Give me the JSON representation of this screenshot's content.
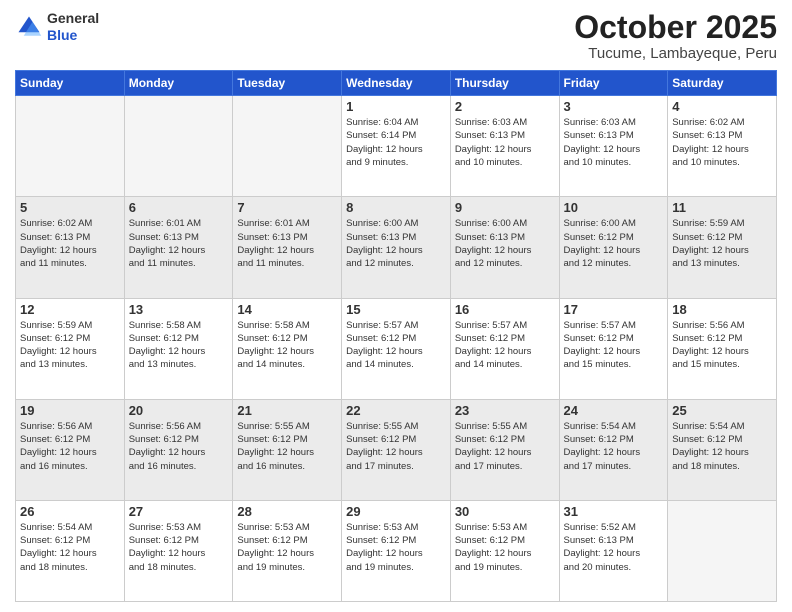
{
  "logo": {
    "general": "General",
    "blue": "Blue"
  },
  "header": {
    "month": "October 2025",
    "location": "Tucume, Lambayeque, Peru"
  },
  "weekdays": [
    "Sunday",
    "Monday",
    "Tuesday",
    "Wednesday",
    "Thursday",
    "Friday",
    "Saturday"
  ],
  "weeks": [
    {
      "shaded": false,
      "days": [
        {
          "num": "",
          "info": ""
        },
        {
          "num": "",
          "info": ""
        },
        {
          "num": "",
          "info": ""
        },
        {
          "num": "1",
          "info": "Sunrise: 6:04 AM\nSunset: 6:14 PM\nDaylight: 12 hours\nand 9 minutes."
        },
        {
          "num": "2",
          "info": "Sunrise: 6:03 AM\nSunset: 6:13 PM\nDaylight: 12 hours\nand 10 minutes."
        },
        {
          "num": "3",
          "info": "Sunrise: 6:03 AM\nSunset: 6:13 PM\nDaylight: 12 hours\nand 10 minutes."
        },
        {
          "num": "4",
          "info": "Sunrise: 6:02 AM\nSunset: 6:13 PM\nDaylight: 12 hours\nand 10 minutes."
        }
      ]
    },
    {
      "shaded": true,
      "days": [
        {
          "num": "5",
          "info": "Sunrise: 6:02 AM\nSunset: 6:13 PM\nDaylight: 12 hours\nand 11 minutes."
        },
        {
          "num": "6",
          "info": "Sunrise: 6:01 AM\nSunset: 6:13 PM\nDaylight: 12 hours\nand 11 minutes."
        },
        {
          "num": "7",
          "info": "Sunrise: 6:01 AM\nSunset: 6:13 PM\nDaylight: 12 hours\nand 11 minutes."
        },
        {
          "num": "8",
          "info": "Sunrise: 6:00 AM\nSunset: 6:13 PM\nDaylight: 12 hours\nand 12 minutes."
        },
        {
          "num": "9",
          "info": "Sunrise: 6:00 AM\nSunset: 6:13 PM\nDaylight: 12 hours\nand 12 minutes."
        },
        {
          "num": "10",
          "info": "Sunrise: 6:00 AM\nSunset: 6:12 PM\nDaylight: 12 hours\nand 12 minutes."
        },
        {
          "num": "11",
          "info": "Sunrise: 5:59 AM\nSunset: 6:12 PM\nDaylight: 12 hours\nand 13 minutes."
        }
      ]
    },
    {
      "shaded": false,
      "days": [
        {
          "num": "12",
          "info": "Sunrise: 5:59 AM\nSunset: 6:12 PM\nDaylight: 12 hours\nand 13 minutes."
        },
        {
          "num": "13",
          "info": "Sunrise: 5:58 AM\nSunset: 6:12 PM\nDaylight: 12 hours\nand 13 minutes."
        },
        {
          "num": "14",
          "info": "Sunrise: 5:58 AM\nSunset: 6:12 PM\nDaylight: 12 hours\nand 14 minutes."
        },
        {
          "num": "15",
          "info": "Sunrise: 5:57 AM\nSunset: 6:12 PM\nDaylight: 12 hours\nand 14 minutes."
        },
        {
          "num": "16",
          "info": "Sunrise: 5:57 AM\nSunset: 6:12 PM\nDaylight: 12 hours\nand 14 minutes."
        },
        {
          "num": "17",
          "info": "Sunrise: 5:57 AM\nSunset: 6:12 PM\nDaylight: 12 hours\nand 15 minutes."
        },
        {
          "num": "18",
          "info": "Sunrise: 5:56 AM\nSunset: 6:12 PM\nDaylight: 12 hours\nand 15 minutes."
        }
      ]
    },
    {
      "shaded": true,
      "days": [
        {
          "num": "19",
          "info": "Sunrise: 5:56 AM\nSunset: 6:12 PM\nDaylight: 12 hours\nand 16 minutes."
        },
        {
          "num": "20",
          "info": "Sunrise: 5:56 AM\nSunset: 6:12 PM\nDaylight: 12 hours\nand 16 minutes."
        },
        {
          "num": "21",
          "info": "Sunrise: 5:55 AM\nSunset: 6:12 PM\nDaylight: 12 hours\nand 16 minutes."
        },
        {
          "num": "22",
          "info": "Sunrise: 5:55 AM\nSunset: 6:12 PM\nDaylight: 12 hours\nand 17 minutes."
        },
        {
          "num": "23",
          "info": "Sunrise: 5:55 AM\nSunset: 6:12 PM\nDaylight: 12 hours\nand 17 minutes."
        },
        {
          "num": "24",
          "info": "Sunrise: 5:54 AM\nSunset: 6:12 PM\nDaylight: 12 hours\nand 17 minutes."
        },
        {
          "num": "25",
          "info": "Sunrise: 5:54 AM\nSunset: 6:12 PM\nDaylight: 12 hours\nand 18 minutes."
        }
      ]
    },
    {
      "shaded": false,
      "days": [
        {
          "num": "26",
          "info": "Sunrise: 5:54 AM\nSunset: 6:12 PM\nDaylight: 12 hours\nand 18 minutes."
        },
        {
          "num": "27",
          "info": "Sunrise: 5:53 AM\nSunset: 6:12 PM\nDaylight: 12 hours\nand 18 minutes."
        },
        {
          "num": "28",
          "info": "Sunrise: 5:53 AM\nSunset: 6:12 PM\nDaylight: 12 hours\nand 19 minutes."
        },
        {
          "num": "29",
          "info": "Sunrise: 5:53 AM\nSunset: 6:12 PM\nDaylight: 12 hours\nand 19 minutes."
        },
        {
          "num": "30",
          "info": "Sunrise: 5:53 AM\nSunset: 6:12 PM\nDaylight: 12 hours\nand 19 minutes."
        },
        {
          "num": "31",
          "info": "Sunrise: 5:52 AM\nSunset: 6:13 PM\nDaylight: 12 hours\nand 20 minutes."
        },
        {
          "num": "",
          "info": ""
        }
      ]
    }
  ]
}
